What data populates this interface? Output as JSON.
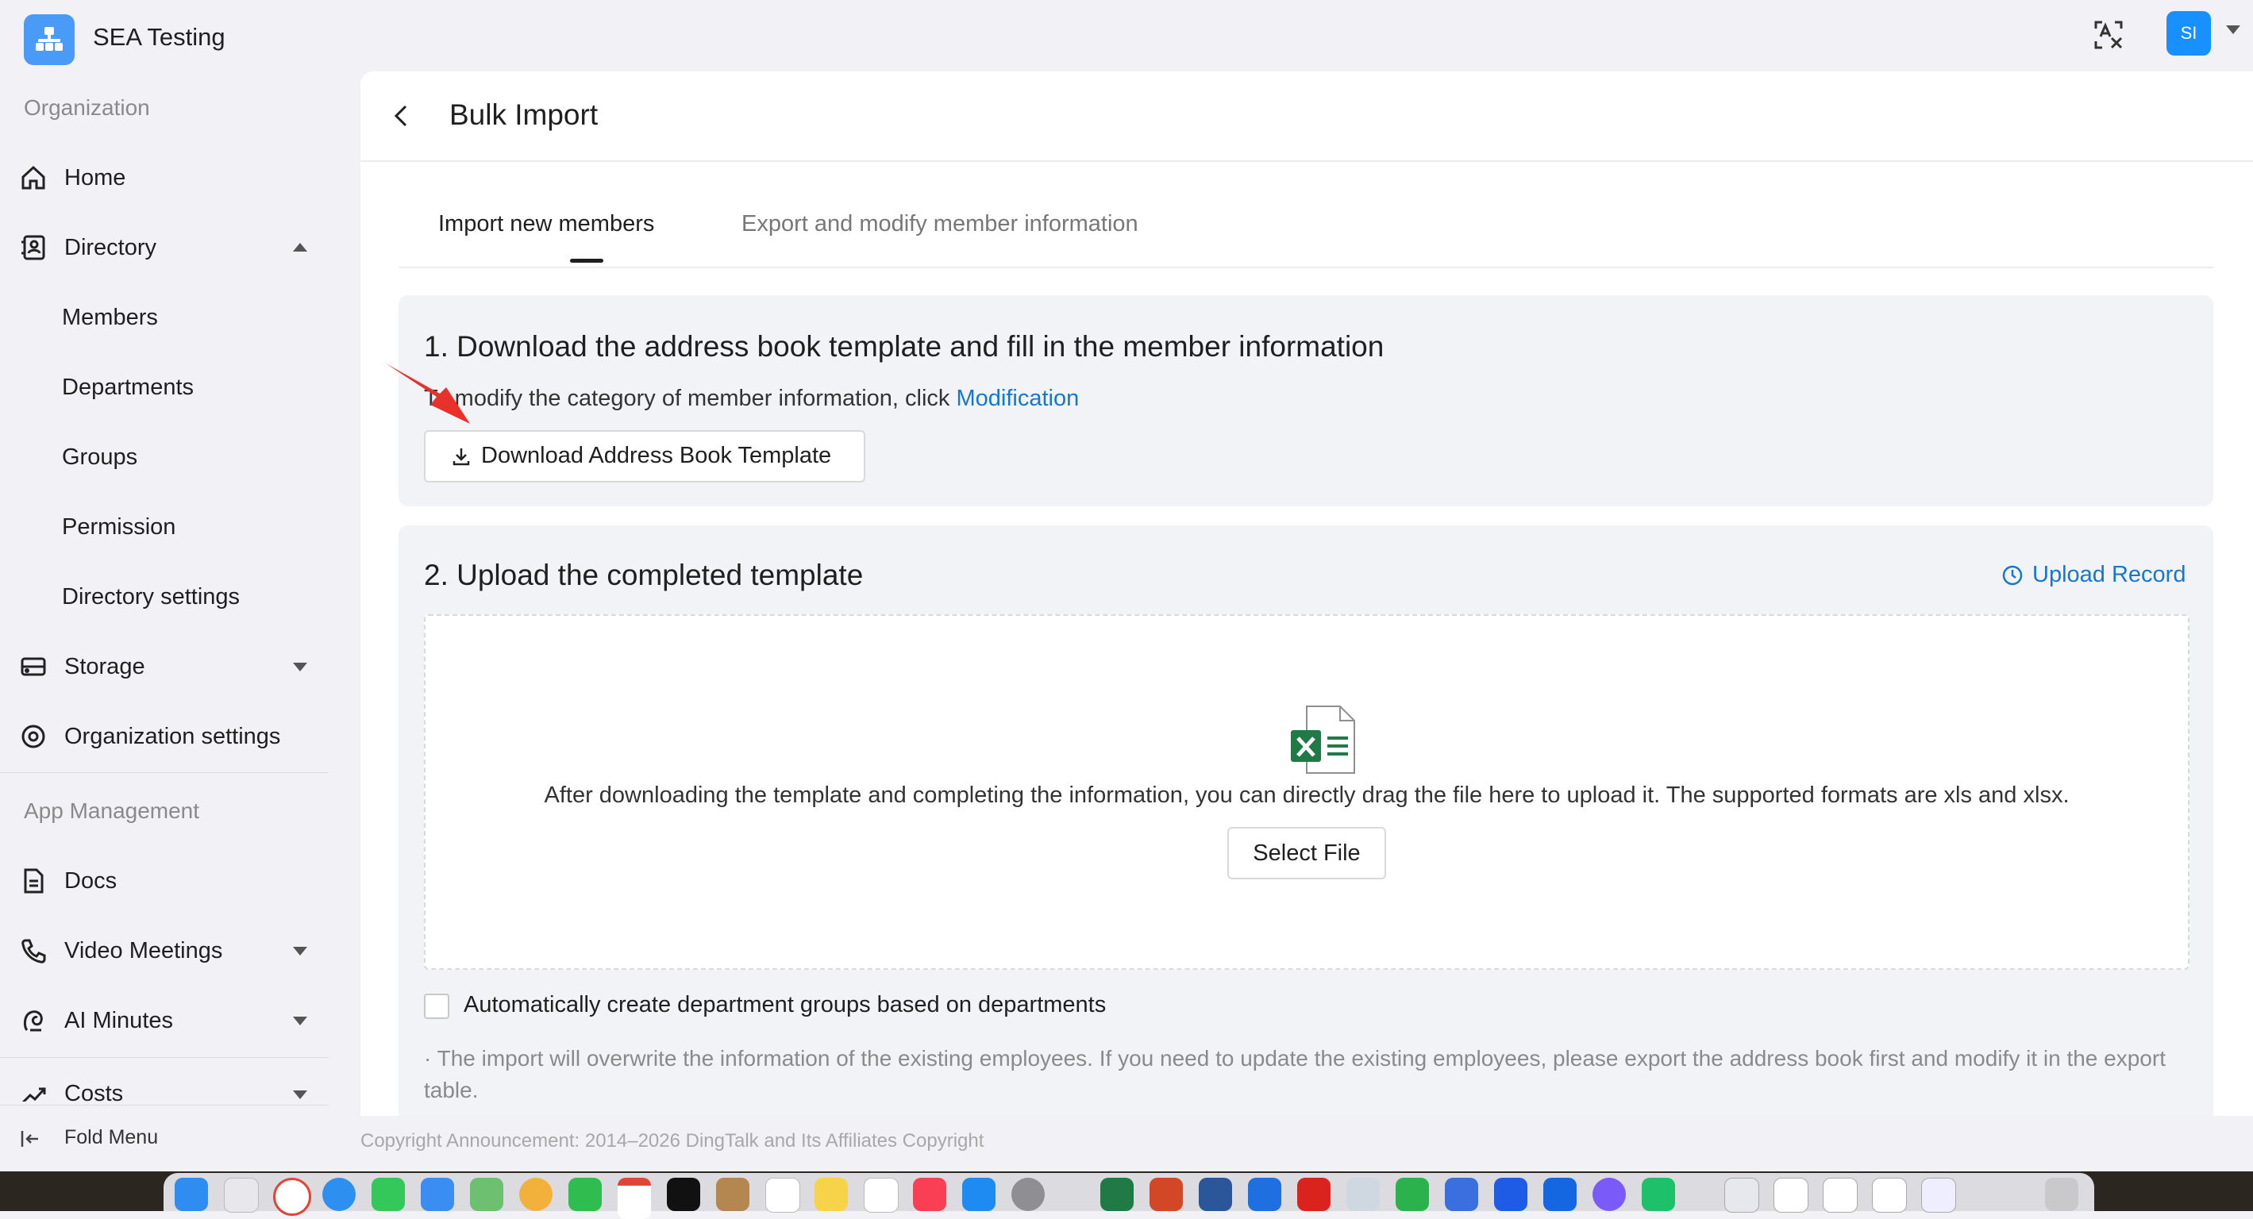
{
  "app": {
    "org_name": "SEA Testing",
    "avatar_initials": "SI"
  },
  "sidebar": {
    "section_organization": "Organization",
    "home": "Home",
    "directory": "Directory",
    "directory_items": [
      "Members",
      "Departments",
      "Groups",
      "Permission",
      "Directory settings"
    ],
    "storage": "Storage",
    "organization_settings": "Organization settings",
    "section_app_management": "App Management",
    "docs": "Docs",
    "video_meetings": "Video Meetings",
    "ai_minutes": "AI Minutes",
    "costs": "Costs",
    "fold_menu": "Fold Menu"
  },
  "page": {
    "title": "Bulk Import",
    "tabs": [
      {
        "label": "Import new members",
        "active": true
      },
      {
        "label": "Export and modify member information",
        "active": false
      }
    ]
  },
  "step1": {
    "title": "1. Download the address book template and fill in the member information",
    "desc_prefix": "To modify the category of member information, click",
    "desc_link": "Modification",
    "download_button": "Download Address Book Template"
  },
  "step2": {
    "title": "2. Upload the completed template",
    "upload_record": "Upload Record",
    "drop_text": "After downloading the template and completing the information, you can directly drag the file here to upload it. The supported formats are xls and xlsx.",
    "select_file": "Select File",
    "checkbox_label": "Automatically create department groups based on departments",
    "checkbox_checked": false,
    "note": "· The import will overwrite the information of the existing employees. If you need to update the existing employees, please export the address book first and modify it in the export table."
  },
  "footer": {
    "copyright": "Copyright Announcement: 2014–2026 DingTalk and Its Affiliates Copyright"
  },
  "colors": {
    "accent": "#1677cc",
    "avatar": "#1890ff",
    "logo": "#4a9bf7",
    "annotation_arrow": "#e8312a"
  }
}
